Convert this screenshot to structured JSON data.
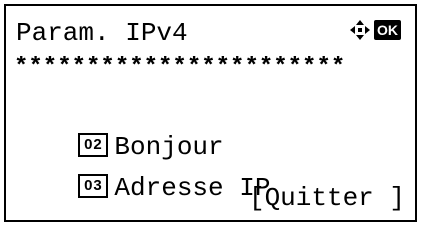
{
  "header": {
    "title": "Param. IPv4",
    "nav_icon": "four-way-arrow-icon",
    "ok_label": "OK",
    "mask": "***********************"
  },
  "menu": {
    "items": [
      {
        "number": "02",
        "label": "Bonjour"
      },
      {
        "number": "03",
        "label": "Adresse IP"
      }
    ]
  },
  "footer": {
    "exit_label": "[Quitter ]"
  }
}
